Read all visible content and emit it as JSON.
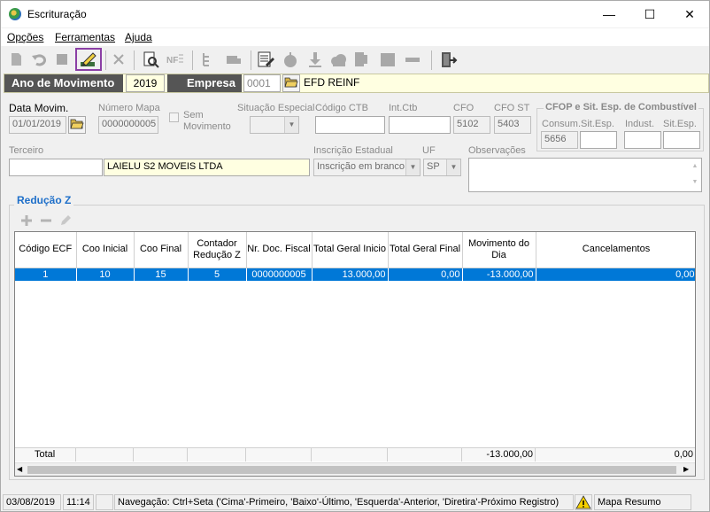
{
  "window": {
    "title": "Escrituração",
    "minimize": "—",
    "maximize": "☐",
    "close": "✕"
  },
  "menu": {
    "items": [
      "Opções",
      "Ferramentas",
      "Ajuda"
    ]
  },
  "header": {
    "ano_label": "Ano de Movimento",
    "ano_value": "2019",
    "empresa_label": "Empresa",
    "empresa_code": "0001",
    "empresa_name": "EFD REINF"
  },
  "form": {
    "data_movim_label": "Data Movim.",
    "data_movim_value": "01/01/2019",
    "numero_mapa_label": "Número Mapa",
    "numero_mapa_value": "0000000005",
    "sem_movimento_label": "Sem Movimento",
    "situacao_label": "Situação Especial",
    "situacao_value": "",
    "codigo_ctb_label": "Código CTB",
    "codigo_ctb_value": "",
    "int_ctb_label": "Int.Ctb",
    "int_ctb_value": "",
    "cfo_label": "CFO",
    "cfo_value": "5102",
    "cfo_st_label": "CFO ST",
    "cfo_st_value": "5403",
    "cfop_group_label": "CFOP e Sit. Esp. de Combustível",
    "consum_label": "Consum.",
    "consum_value": "5656",
    "sit_esp1_label": "Sit.Esp.",
    "sit_esp1_value": "",
    "indust_label": "Indust.",
    "indust_value": "",
    "sit_esp2_label": "Sit.Esp.",
    "sit_esp2_value": "",
    "terceiro_label": "Terceiro",
    "terceiro_code": "",
    "terceiro_name": "LAIELU S2 MOVEIS LTDA",
    "inscricao_label": "Inscrição Estadual",
    "inscricao_value": "Inscrição em branco",
    "uf_label": "UF",
    "uf_value": "SP",
    "observacoes_label": "Observações",
    "observacoes_value": ""
  },
  "reducao": {
    "title": "Redução Z",
    "columns": [
      "Código ECF",
      "Coo Inicial",
      "Coo Final",
      "Contador Redução Z",
      "Nr. Doc. Fiscal",
      "Total Geral Inicio",
      "Total Geral Final",
      "Movimento do Dia",
      "Cancelamentos"
    ],
    "rows": [
      [
        "1",
        "10",
        "15",
        "5",
        "0000000005",
        "13.000,00",
        "0,00",
        "-13.000,00",
        "0,00"
      ]
    ],
    "footer": {
      "label": "Total",
      "movimento": "-13.000,00",
      "cancelamentos": "0,00"
    }
  },
  "status": {
    "date": "03/08/2019",
    "time": "11:14",
    "navigation": "Navegação: Ctrl+Seta ('Cima'-Primeiro, 'Baixo'-Último, 'Esquerda'-Anterior, 'Diretira'-Próximo Registro)",
    "mode": "Mapa Resumo"
  }
}
